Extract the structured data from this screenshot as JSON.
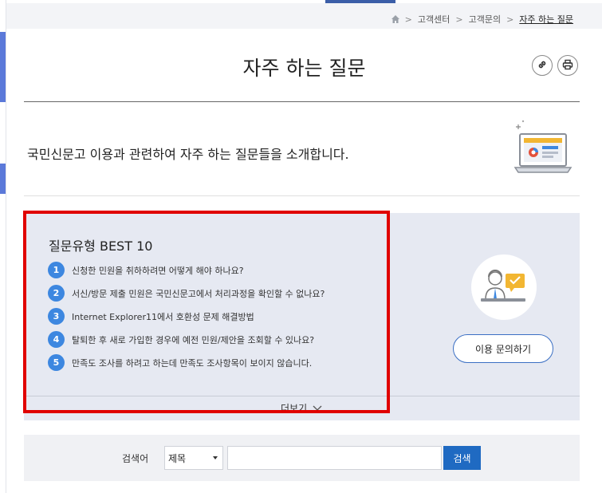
{
  "breadcrumb": {
    "home_icon": "home-icon",
    "items": [
      "고객센터",
      "고객문의",
      "자주 하는 질문"
    ]
  },
  "page": {
    "title": "자주 하는 질문",
    "intro": "국민신문고 이용과 관련하여 자주 하는 질문들을 소개합니다."
  },
  "actions": {
    "link_icon": "link-icon",
    "print_icon": "print-icon"
  },
  "faq": {
    "title": "질문유형 BEST 10",
    "items": [
      {
        "num": "1",
        "text": "신청한 민원을 취하하려면 어떻게 해야 하나요?"
      },
      {
        "num": "2",
        "text": "서신/방문 제출 민원은 국민신문고에서 처리과정을 확인할 수 없나요?"
      },
      {
        "num": "3",
        "text": "Internet Explorer11에서 호환성 문제 해결방법"
      },
      {
        "num": "4",
        "text": "탈퇴한 후 새로 가입한 경우에 예전 민원/제안을 조회할 수 있나요?"
      },
      {
        "num": "5",
        "text": "만족도 조사를 하려고 하는데 만족도 조사항목이 보이지 않습니다."
      }
    ],
    "more_label": "더보기"
  },
  "inquiry": {
    "button_label": "이용 문의하기"
  },
  "search": {
    "label": "검색어",
    "select_value": "제목",
    "input_value": "",
    "button_label": "검색"
  },
  "colors": {
    "accent": "#3d87e0",
    "search_button": "#1f6ac2",
    "highlight_border": "#e00000",
    "faq_background": "#e6e9f2"
  }
}
